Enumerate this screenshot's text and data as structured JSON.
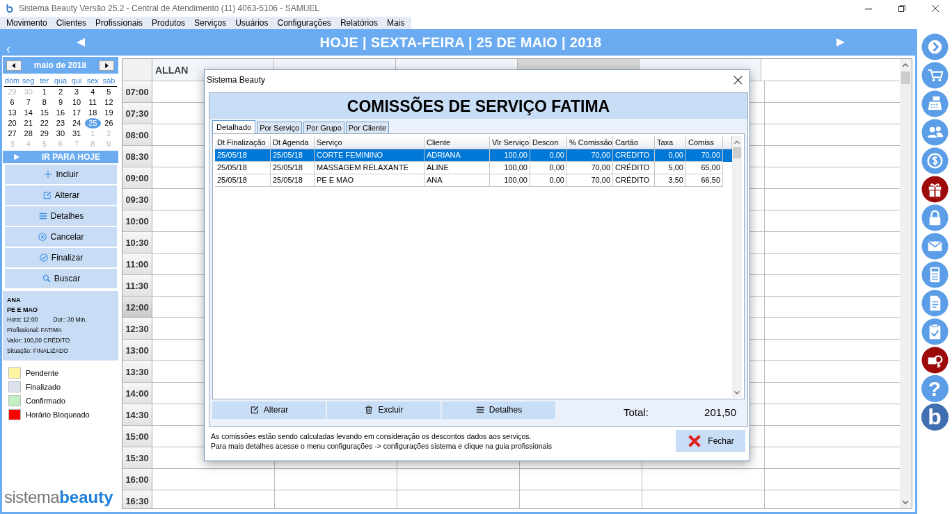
{
  "window": {
    "title": "Sistema Beauty Versão 25.2 - Central de Atendimento (11) 4063-5106 - SAMUEL"
  },
  "menu": [
    {
      "label": "Movimento"
    },
    {
      "label": "Clientes"
    },
    {
      "label": "Profissionais"
    },
    {
      "label": "Produtos"
    },
    {
      "label": "Serviços"
    },
    {
      "label": "Usuários"
    },
    {
      "label": "Configurações"
    },
    {
      "label": "Relatórios"
    },
    {
      "label": "Mais"
    }
  ],
  "header": {
    "title": "HOJE | SEXTA-FEIRA | 25 DE MAIO | 2018"
  },
  "calendar": {
    "month": "maio de 2018",
    "weekdays": [
      "dom",
      "seg",
      "ter",
      "qua",
      "qui",
      "sex",
      "sáb"
    ],
    "weeks": [
      [
        {
          "day": "29",
          "in_month": false,
          "selected": false
        },
        {
          "day": "30",
          "in_month": false,
          "selected": false
        },
        {
          "day": "1",
          "in_month": true,
          "selected": false
        },
        {
          "day": "2",
          "in_month": true,
          "selected": false
        },
        {
          "day": "3",
          "in_month": true,
          "selected": false
        },
        {
          "day": "4",
          "in_month": true,
          "selected": false
        },
        {
          "day": "5",
          "in_month": true,
          "selected": false
        }
      ],
      [
        {
          "day": "6",
          "in_month": true,
          "selected": false
        },
        {
          "day": "7",
          "in_month": true,
          "selected": false
        },
        {
          "day": "8",
          "in_month": true,
          "selected": false
        },
        {
          "day": "9",
          "in_month": true,
          "selected": false
        },
        {
          "day": "10",
          "in_month": true,
          "selected": false
        },
        {
          "day": "11",
          "in_month": true,
          "selected": false
        },
        {
          "day": "12",
          "in_month": true,
          "selected": false
        }
      ],
      [
        {
          "day": "13",
          "in_month": true,
          "selected": false
        },
        {
          "day": "14",
          "in_month": true,
          "selected": false
        },
        {
          "day": "15",
          "in_month": true,
          "selected": false
        },
        {
          "day": "16",
          "in_month": true,
          "selected": false
        },
        {
          "day": "17",
          "in_month": true,
          "selected": false
        },
        {
          "day": "18",
          "in_month": true,
          "selected": false
        },
        {
          "day": "19",
          "in_month": true,
          "selected": false
        }
      ],
      [
        {
          "day": "20",
          "in_month": true,
          "selected": false
        },
        {
          "day": "21",
          "in_month": true,
          "selected": false
        },
        {
          "day": "22",
          "in_month": true,
          "selected": false
        },
        {
          "day": "23",
          "in_month": true,
          "selected": false
        },
        {
          "day": "24",
          "in_month": true,
          "selected": false
        },
        {
          "day": "25",
          "in_month": true,
          "selected": true
        },
        {
          "day": "26",
          "in_month": true,
          "selected": false
        }
      ],
      [
        {
          "day": "27",
          "in_month": true,
          "selected": false
        },
        {
          "day": "28",
          "in_month": true,
          "selected": false
        },
        {
          "day": "29",
          "in_month": true,
          "selected": false
        },
        {
          "day": "30",
          "in_month": true,
          "selected": false
        },
        {
          "day": "31",
          "in_month": true,
          "selected": false
        },
        {
          "day": "1",
          "in_month": false,
          "selected": false
        },
        {
          "day": "2",
          "in_month": false,
          "selected": false
        }
      ],
      [
        {
          "day": "3",
          "in_month": false,
          "selected": false
        },
        {
          "day": "4",
          "in_month": false,
          "selected": false
        },
        {
          "day": "5",
          "in_month": false,
          "selected": false
        },
        {
          "day": "6",
          "in_month": false,
          "selected": false
        },
        {
          "day": "7",
          "in_month": false,
          "selected": false
        },
        {
          "day": "8",
          "in_month": false,
          "selected": false
        },
        {
          "day": "9",
          "in_month": false,
          "selected": false
        }
      ]
    ]
  },
  "today_button": {
    "label": "IR PARA HOJE"
  },
  "actions": [
    {
      "label": "Incluir",
      "kind": "add"
    },
    {
      "label": "Alterar",
      "kind": "edit"
    },
    {
      "label": "Detalhes",
      "kind": "list"
    },
    {
      "label": "Cancelar",
      "kind": "cancel"
    },
    {
      "label": "Finalizar",
      "kind": "check"
    },
    {
      "label": "Buscar",
      "kind": "search"
    }
  ],
  "appointment": {
    "client": "ANA",
    "service": "PE E MAO",
    "time": "Hora: 12:00",
    "duration": "Dur.: 30 Min.",
    "professional": "Profissional: FATIMA",
    "value": "Valor: 100,00 CRÉDITO",
    "status": "Situação: FINALIZADO"
  },
  "legend": [
    {
      "label": "Pendente",
      "color": "#fff5a0"
    },
    {
      "label": "Finalizado",
      "color": "#dde3ee"
    },
    {
      "label": "Confirmado",
      "color": "#c2f0c2"
    },
    {
      "label": "Horário Bloqueado",
      "color": "#ff0000"
    }
  ],
  "logo": {
    "light": "sistema",
    "bold": "beauty"
  },
  "schedule": {
    "professionals": [
      {
        "name": "ALLAN",
        "selected": false
      },
      {
        "selected": false
      },
      {
        "selected": false
      },
      {
        "selected": true
      },
      {
        "selected": false
      }
    ],
    "times": [
      {
        "time": "07:00",
        "current": false
      },
      {
        "time": "07:30",
        "current": false
      },
      {
        "time": "08:00",
        "current": false
      },
      {
        "time": "08:30",
        "current": false
      },
      {
        "time": "09:00",
        "current": false
      },
      {
        "time": "09:30",
        "current": false
      },
      {
        "time": "10:00",
        "current": false
      },
      {
        "time": "10:30",
        "current": false
      },
      {
        "time": "11:00",
        "current": false
      },
      {
        "time": "11:30",
        "current": false
      },
      {
        "time": "12:00",
        "current": true
      },
      {
        "time": "12:30",
        "current": false
      },
      {
        "time": "13:00",
        "current": false
      },
      {
        "time": "13:30",
        "current": false
      },
      {
        "time": "14:00",
        "current": false
      },
      {
        "time": "14:30",
        "current": false
      },
      {
        "time": "15:00",
        "current": false
      },
      {
        "time": "15:30",
        "current": false
      },
      {
        "time": "16:00",
        "current": false
      },
      {
        "time": "16:30",
        "current": false
      }
    ]
  },
  "sidebar_icons": [
    {
      "kind": "next",
      "color": "#5b9de6"
    },
    {
      "kind": "cart",
      "color": "#5b9de6"
    },
    {
      "kind": "register",
      "color": "#5b9de6"
    },
    {
      "kind": "people",
      "color": "#5b9de6"
    },
    {
      "kind": "money",
      "color": "#5b9de6"
    },
    {
      "kind": "gift",
      "color": "#9c0a0a"
    },
    {
      "kind": "lock",
      "color": "#5b9de6"
    },
    {
      "kind": "mail",
      "color": "#5b9de6"
    },
    {
      "kind": "calculator",
      "color": "#5b9de6"
    },
    {
      "kind": "document",
      "color": "#5b9de6"
    },
    {
      "kind": "clipboard",
      "color": "#5b9de6"
    },
    {
      "kind": "key",
      "color": "#9c0a0a"
    },
    {
      "kind": "help",
      "color": "#5b9de6",
      "label": "?"
    },
    {
      "kind": "brand",
      "color": "#3f6fb0",
      "label": "b"
    }
  ],
  "dialog": {
    "title": "Sistema Beauty",
    "heading": "COMISSÕES DE SERVIÇO FATIMA",
    "tabs": [
      {
        "label": "Detalhado",
        "selected": true
      },
      {
        "label": "Por Serviço",
        "selected": false
      },
      {
        "label": "Por Grupo",
        "selected": false
      },
      {
        "label": "Por Cliente",
        "selected": false
      }
    ],
    "table": {
      "columns": [
        {
          "label": "Dt Finalização",
          "numeric": false
        },
        {
          "label": "Dt Agenda",
          "numeric": false
        },
        {
          "label": "Serviço",
          "numeric": false
        },
        {
          "label": "Cliente",
          "numeric": false
        },
        {
          "label": "Vlr Serviço",
          "numeric": true
        },
        {
          "label": "Descon",
          "numeric": true
        },
        {
          "label": "% Comissão",
          "numeric": true
        },
        {
          "label": "Cartão",
          "numeric": false
        },
        {
          "label": "Taxa",
          "numeric": true
        },
        {
          "label": "Comiss",
          "numeric": true
        }
      ],
      "rows": [
        {
          "selected": true,
          "cells": [
            "25/05/18",
            "25/05/18",
            "CORTE FEMININO",
            "ADRIANA",
            "100,00",
            "0,00",
            "70,00",
            "CRÉDITO",
            "0,00",
            "70,00"
          ]
        },
        {
          "selected": false,
          "cells": [
            "25/05/18",
            "25/05/18",
            "MASSAGEM RELAXANTE",
            "ALINE",
            "100,00",
            "0,00",
            "70,00",
            "CRÉDITO",
            "5,00",
            "65,00"
          ]
        },
        {
          "selected": false,
          "cells": [
            "25/05/18",
            "25/05/18",
            "PE E MAO",
            "ANA",
            "100,00",
            "0,00",
            "70,00",
            "CRÉDITO",
            "3,50",
            "66,50"
          ]
        }
      ]
    },
    "buttons": [
      {
        "label": "Alterar",
        "kind": "edit"
      },
      {
        "label": "Excluir",
        "kind": "delete"
      },
      {
        "label": "Detalhes",
        "kind": "list"
      }
    ],
    "total_label": "Total:",
    "total": "201,50",
    "notes": [
      "As comissões estão sendo calculadas levando em consideração os descontos dados aos serviços.",
      "Para mais detalhes acesse o menu configurações -> configurações sistema e clique na guia profissionais"
    ],
    "close_button": {
      "label": "Fechar"
    }
  }
}
